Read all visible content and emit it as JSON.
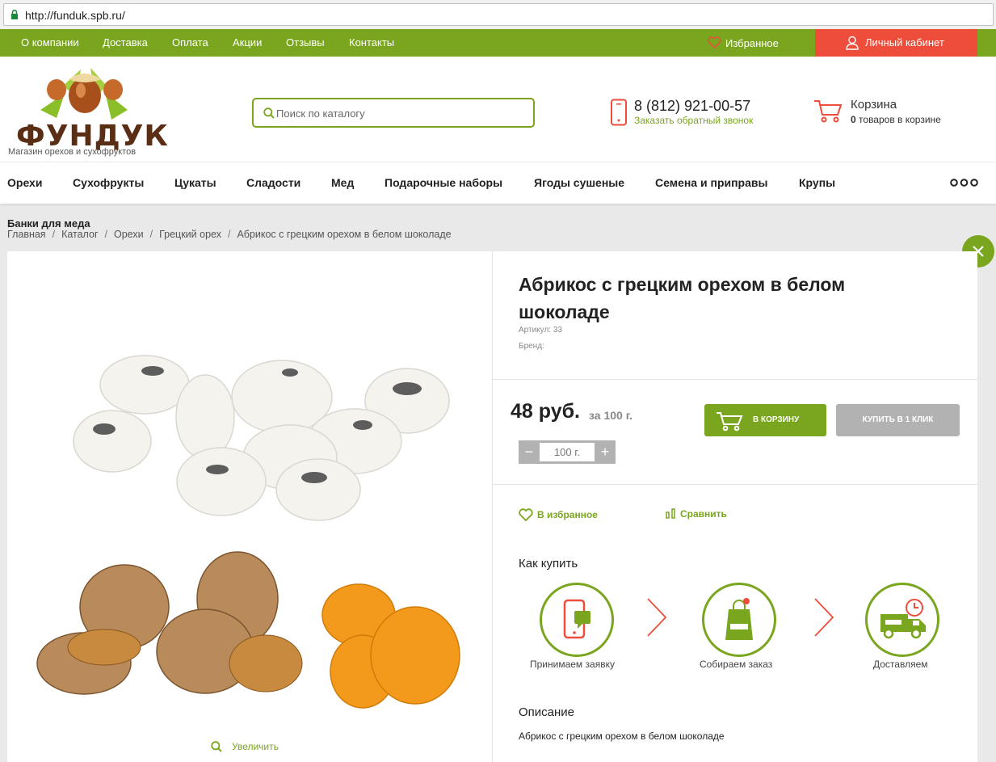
{
  "browser": {
    "url": "http://funduk.spb.ru/"
  },
  "top_nav": {
    "links": [
      "О компании",
      "Доставка",
      "Оплата",
      "Акции",
      "Отзывы",
      "Контакты"
    ],
    "favorites": "Избранное",
    "cabinet": "Личный кабинет"
  },
  "header": {
    "logo_text": "ФУНДУК",
    "logo_tagline": "Магазин орехов и сухофруктов",
    "search_placeholder": "Поиск по каталогу",
    "phone": "8 (812) 921-00-57",
    "callback": "Заказать обратный звонок",
    "cart_title": "Корзина",
    "cart_count": "0",
    "cart_suffix": "товаров в корзине"
  },
  "categories": [
    "Орехи",
    "Сухофрукты",
    "Цукаты",
    "Сладости",
    "Мед",
    "Подарочные наборы",
    "Ягоды сушеные",
    "Семена и приправы",
    "Крупы"
  ],
  "page": {
    "jars_link": "Банки для меда",
    "breadcrumbs": [
      "Главная",
      "Каталог",
      "Орехи",
      "Грецкий орех",
      "Абрикос с грецким орехом в белом шоколаде"
    ]
  },
  "product": {
    "title": "Абрикос с грецким орехом в белом шоколаде",
    "article": "Артикул: 33",
    "brand": "Бренд:",
    "price": "48 руб.",
    "price_per": "за 100 г.",
    "quantity": "100 г.",
    "add_to_cart": "В КОРЗИНУ",
    "buy_one_click": "КУПИТЬ В 1 КЛИК",
    "to_favorites": "В избранное",
    "compare": "Сравнить",
    "zoom": "Увеличить",
    "how_to_buy": "Как купить",
    "steps": [
      "Принимаем заявку",
      "Собираем заказ",
      "Доставляем"
    ],
    "description_title": "Описание",
    "description": "Абрикос с грецким орехом в белом шоколаде"
  },
  "colors": {
    "brand_green": "#7aa51e",
    "accent_red": "#ee4d3b",
    "gray_button": "#b2b2b2"
  }
}
